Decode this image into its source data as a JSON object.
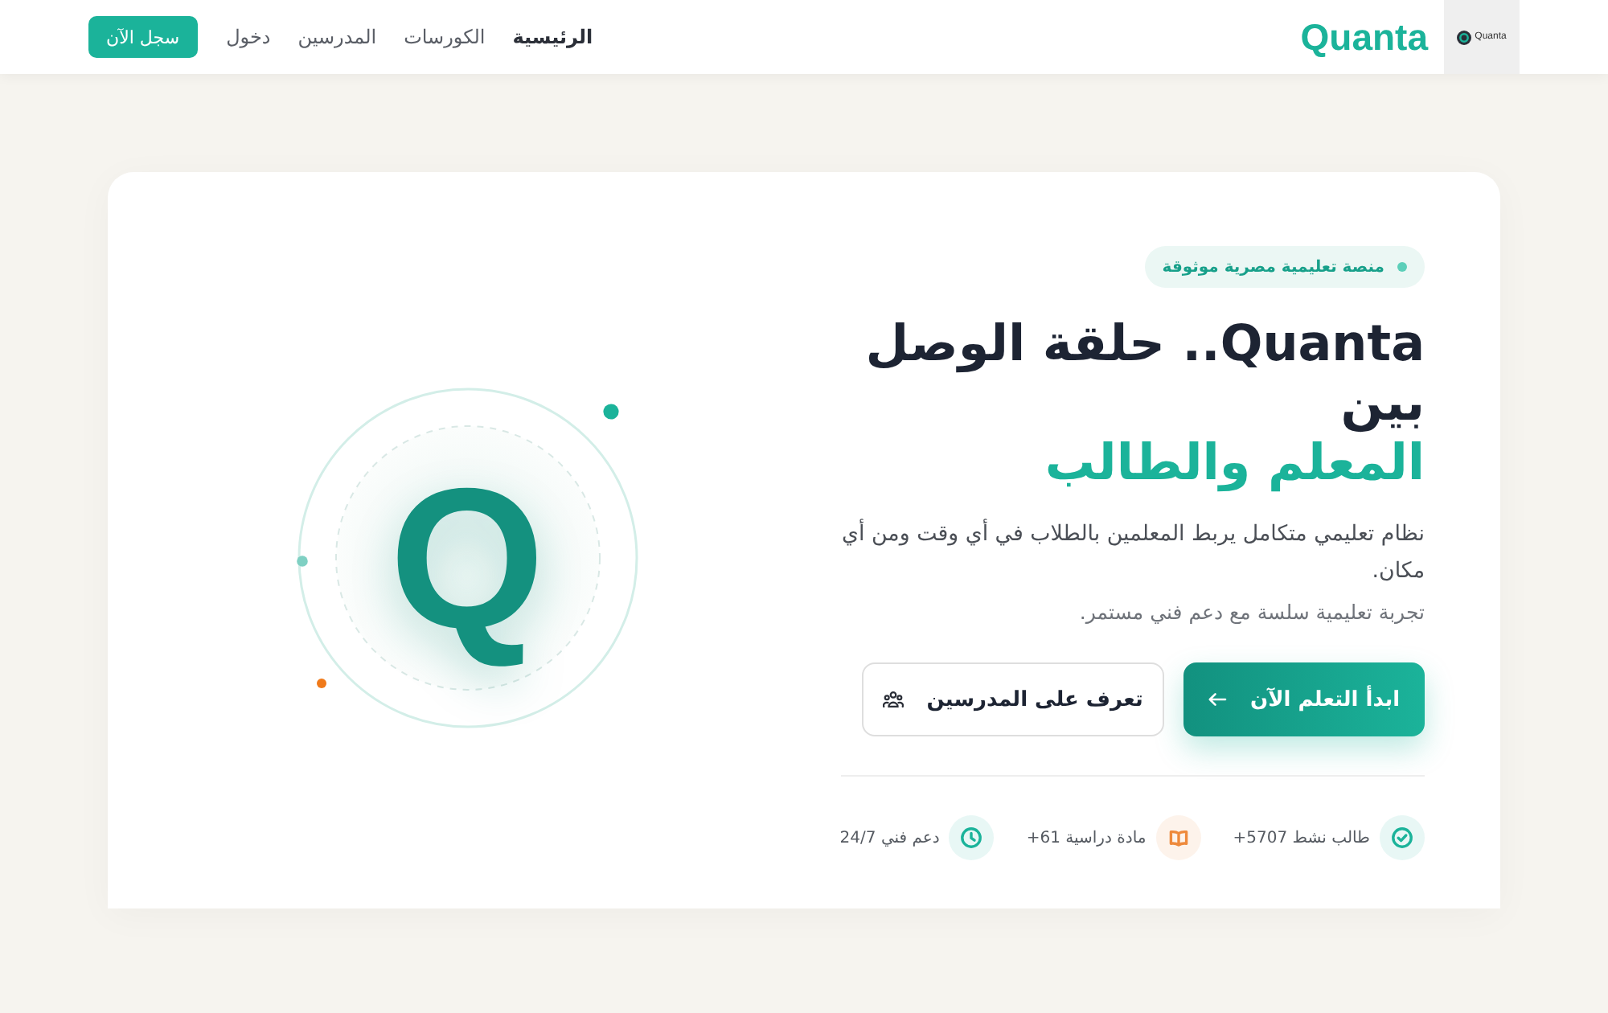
{
  "header": {
    "logo_tile": {
      "caption": "Quanta"
    },
    "brand": "Quanta",
    "nav": [
      {
        "label": "الرئيسية",
        "selected": true
      },
      {
        "label": "الكورسات",
        "selected": false
      },
      {
        "label": "المدرسين",
        "selected": false
      },
      {
        "label": "دخول",
        "selected": false
      }
    ],
    "signup_button": "سجل الآن"
  },
  "hero": {
    "badge": "منصة تعليمية مصرية موثوقة",
    "title": "Quanta.. حلقة الوصل بين",
    "title_highlight": "المعلم والطالب",
    "description": "نظام تعليمي متكامل يربط المعلمين بالطلاب في أي وقت ومن أي مكان.",
    "subtext": "تجربة تعليمية سلسة مع دعم فني مستمر.",
    "buttons": [
      {
        "label": "ابدأ التعلم الآن",
        "kind": "primary"
      },
      {
        "label": "تعرف على المدرسين",
        "kind": "secondary"
      }
    ],
    "stats": [
      {
        "label": "طالب نشط",
        "value": "+5707",
        "color": "#1bb39a"
      },
      {
        "label": "مادة دراسية",
        "value": "+61",
        "color": "#ee8a3c"
      },
      {
        "label": "دعم فني",
        "value": "24/7",
        "color": "#1bb39a"
      }
    ],
    "emblem_letter": "Q"
  }
}
